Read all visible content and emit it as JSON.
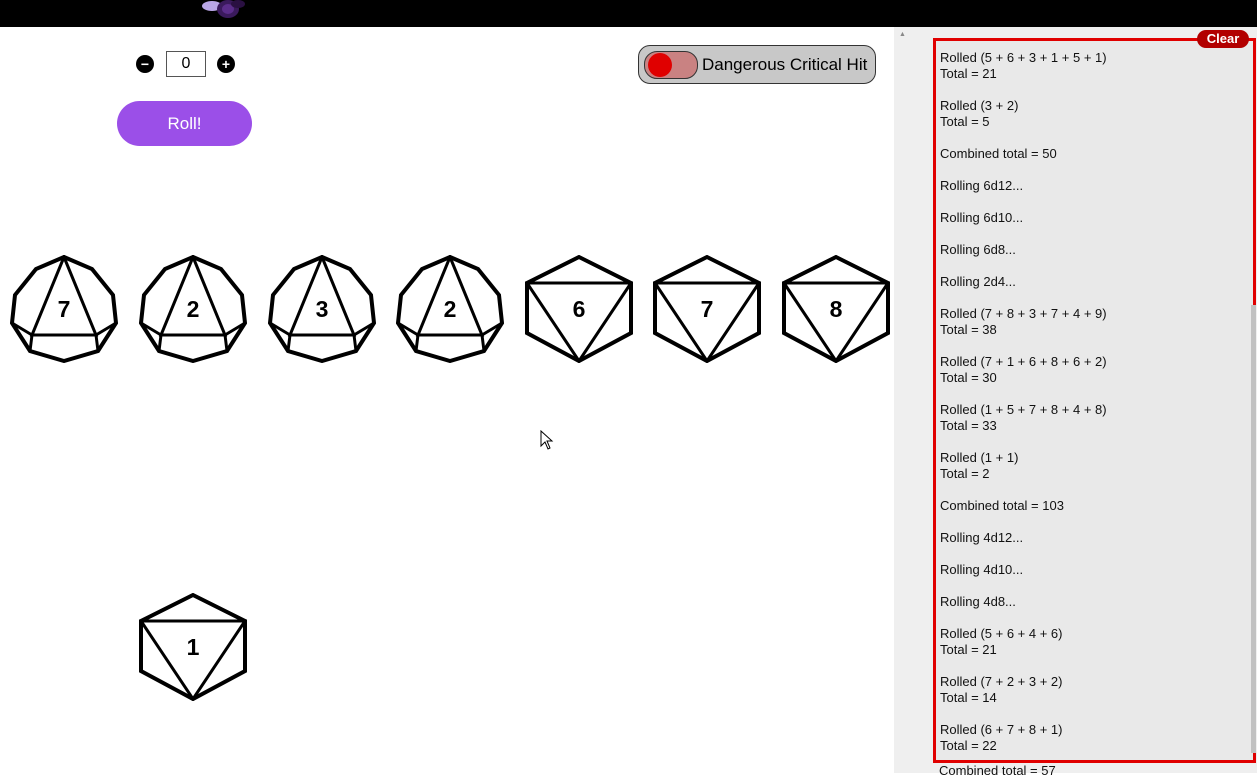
{
  "controls": {
    "decrement_label": "−",
    "count_value": "0",
    "increment_label": "+",
    "roll_label": "Roll!",
    "toggle_label": "Dangerous Critical Hit"
  },
  "dice": [
    {
      "type": "d12",
      "value": "7"
    },
    {
      "type": "d12",
      "value": "2"
    },
    {
      "type": "d12",
      "value": "3"
    },
    {
      "type": "d12",
      "value": "2"
    },
    {
      "type": "d10",
      "value": "6"
    },
    {
      "type": "d10",
      "value": "7"
    },
    {
      "type": "d10",
      "value": "8"
    },
    {
      "type": "d10",
      "value": "1"
    }
  ],
  "log": {
    "clear_label": "Clear",
    "entries": [
      "Rolled (5 + 6 + 3 + 1 + 5 + 1)\nTotal = 21",
      "Rolled (3 + 2)\nTotal = 5",
      "Combined total = 50",
      "Rolling 6d12...",
      "Rolling 6d10...",
      "Rolling 6d8...",
      "Rolling 2d4...",
      "Rolled (7 + 8 + 3 + 7 + 4 + 9)\nTotal = 38",
      "Rolled (7 + 1 + 6 + 8 + 6 + 2)\nTotal = 30",
      "Rolled (1 + 5 + 7 + 8 + 4 + 8)\nTotal = 33",
      "Rolled (1 + 1)\nTotal = 2",
      "Combined total = 103",
      "Rolling 4d12...",
      "Rolling 4d10...",
      "Rolling 4d8...",
      "Rolled (5 + 6 + 4 + 6)\nTotal = 21",
      "Rolled (7 + 2 + 3 + 2)\nTotal = 14",
      "Rolled (6 + 7 + 8 + 1)\nTotal = 22"
    ],
    "overflow_entry": "Combined total = 57"
  }
}
